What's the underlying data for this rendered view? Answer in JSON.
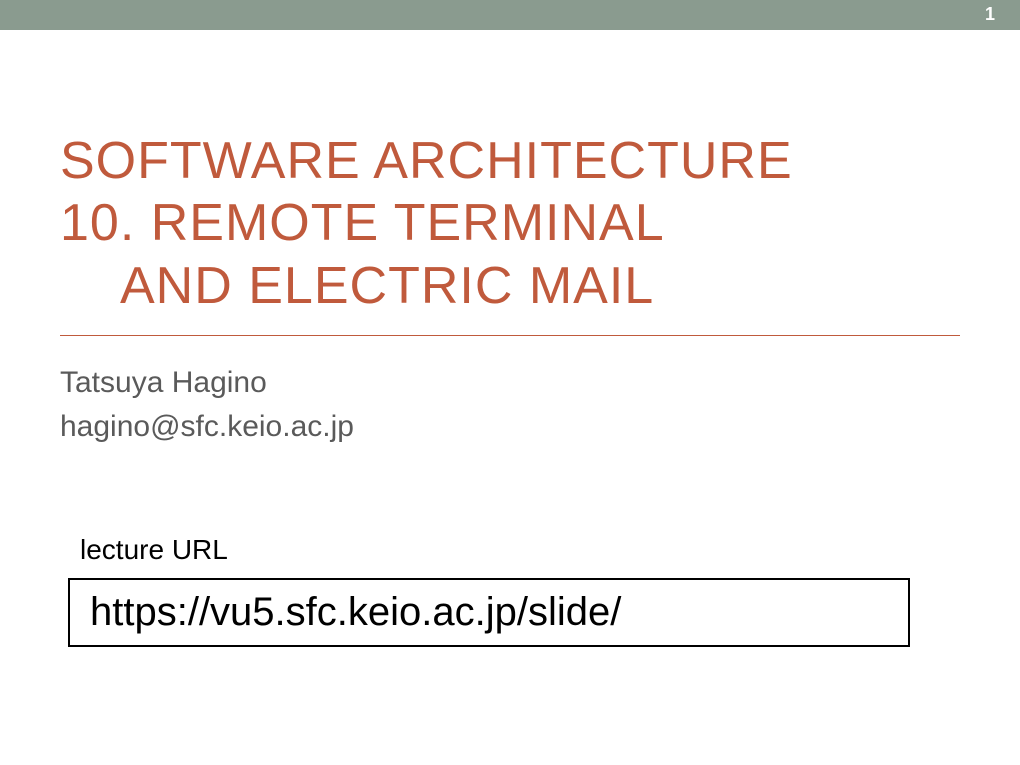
{
  "pageNumber": "1",
  "title": {
    "line1": "SOFTWARE ARCHITECTURE",
    "line2": "10. REMOTE TERMINAL",
    "line3": "AND ELECTRIC MAIL"
  },
  "author": "Tatsuya Hagino",
  "email": "hagino@sfc.keio.ac.jp",
  "urlLabel": "lecture URL",
  "url": "https://vu5.sfc.keio.ac.jp/slide/"
}
